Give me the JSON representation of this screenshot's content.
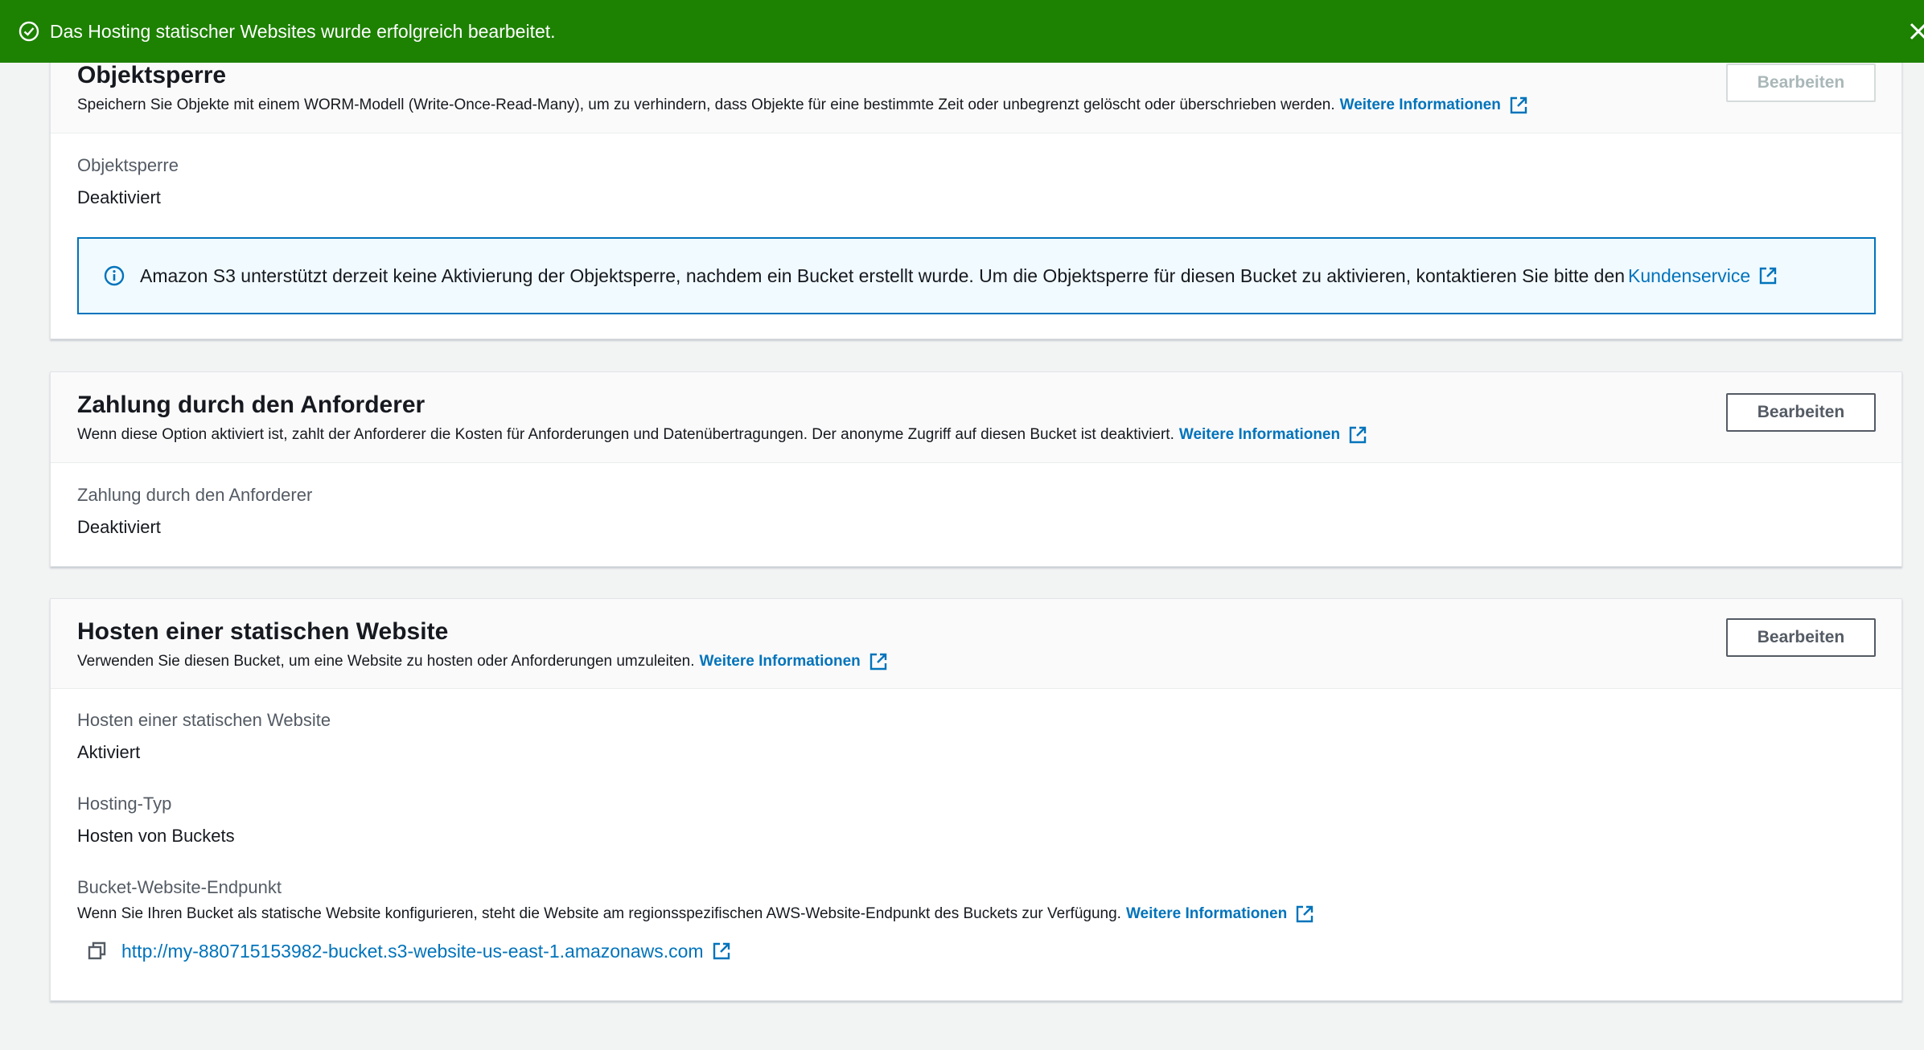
{
  "flash": {
    "message": "Das Hosting statischer Websites wurde erfolgreich bearbeitet.",
    "icon": "check-circle-icon",
    "close_icon": "close-icon",
    "color": "#1d8102"
  },
  "object_lock": {
    "title": "Objektsperre",
    "description": "Speichern Sie Objekte mit einem WORM-Modell (Write-Once-Read-Many), um zu verhindern, dass Objekte für eine bestimmte Zeit oder unbegrenzt gelöscht oder überschrieben werden.",
    "learn_more": "Weitere Informationen",
    "edit_label": "Bearbeiten",
    "field_label": "Objektsperre",
    "field_value": "Deaktiviert",
    "info_text": "Amazon S3 unterstützt derzeit keine Aktivierung der Objektsperre, nachdem ein Bucket erstellt wurde. Um die Objektsperre für diesen Bucket zu aktivieren, kontaktieren Sie bitte den",
    "info_link": "Kundenservice"
  },
  "requester_pays": {
    "title": "Zahlung durch den Anforderer",
    "description": "Wenn diese Option aktiviert ist, zahlt der Anforderer die Kosten für Anforderungen und Datenübertragungen. Der anonyme Zugriff auf diesen Bucket ist deaktiviert.",
    "learn_more": "Weitere Informationen",
    "edit_label": "Bearbeiten",
    "field_label": "Zahlung durch den Anforderer",
    "field_value": "Deaktiviert"
  },
  "static_website": {
    "title": "Hosten einer statischen Website",
    "description": "Verwenden Sie diesen Bucket, um eine Website zu hosten oder Anforderungen umzuleiten.",
    "learn_more": "Weitere Informationen",
    "edit_label": "Bearbeiten",
    "hosting_label": "Hosten einer statischen Website",
    "hosting_value": "Aktiviert",
    "type_label": "Hosting-Typ",
    "type_value": "Hosten von Buckets",
    "endpoint_label": "Bucket-Website-Endpunkt",
    "endpoint_desc": "Wenn Sie Ihren Bucket als statische Website konfigurieren, steht die Website am regionsspezifischen AWS-Website-Endpunkt des Buckets zur Verfügung.",
    "endpoint_learn_more": "Weitere Informationen",
    "endpoint_url": "http://my-880715153982-bucket.s3-website-us-east-1.amazonaws.com"
  },
  "colors": {
    "link": "#0073bb",
    "success": "#1d8102",
    "info_bg": "#f1faff"
  }
}
